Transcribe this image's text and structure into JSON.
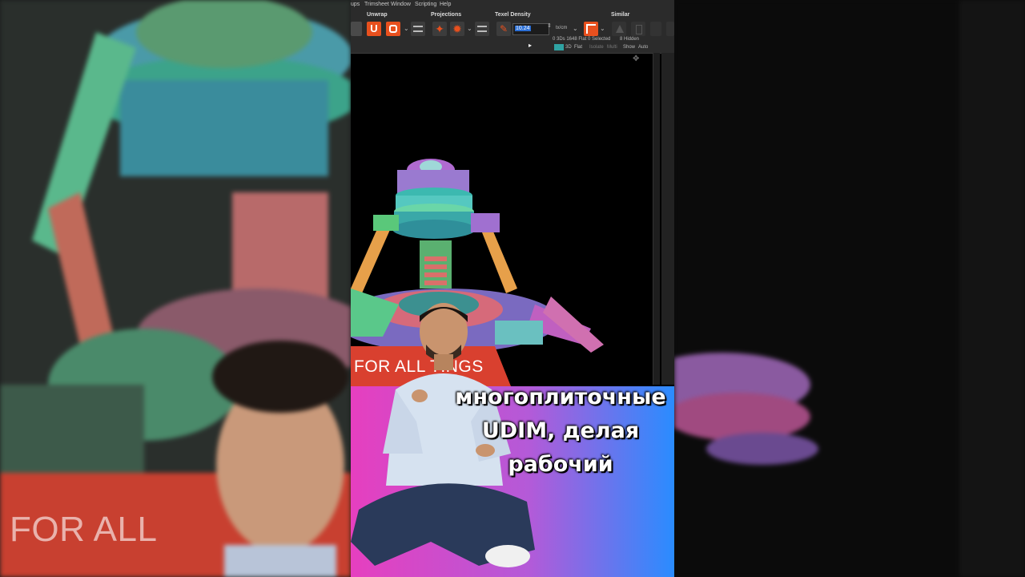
{
  "menu": [
    "ups",
    "Trimsheet",
    "Window",
    "Scripting",
    "Help"
  ],
  "toolbar": {
    "unwrap_label": "Unwrap",
    "projections_label": "Projections",
    "texel_density_label": "Texel Density",
    "similar_label": "Similar",
    "texel_value": "10.24",
    "unit_value": "tx/cm",
    "stats": "0 3Ds 1648 Flat 0 Selected",
    "hidden": "8 Hidden",
    "view_modes": [
      "3D",
      "Flat",
      "Isolate",
      "Multi"
    ],
    "show_label": "Show",
    "auto_label": "Auto"
  },
  "banner_left": "FOR ALL",
  "banner_center": "FOR ALL TINGS",
  "caption_lines": [
    "многоплиточные",
    "UDIM, делая",
    "рабочий"
  ],
  "colors": {
    "banner_red": "#d9402f",
    "toolbar_bg": "#2b2b2b",
    "accent_orange": "#e8501e",
    "gradient_pink": "#e040c0",
    "gradient_blue": "#2a8cff"
  }
}
